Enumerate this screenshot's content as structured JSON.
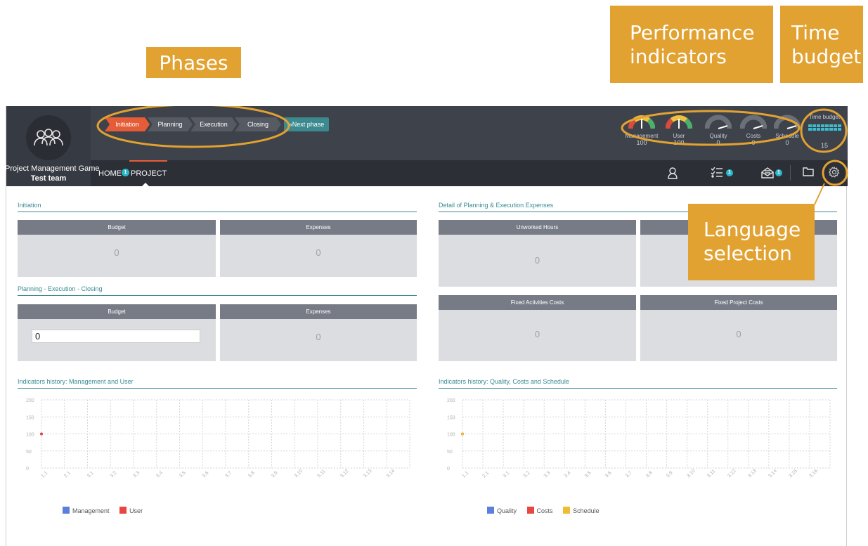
{
  "callouts": {
    "phases": "Phases",
    "performance_indicators": "Performance indicators",
    "time_budget": "Time budget",
    "language_selection": "Language selection"
  },
  "brand": {
    "name": "Project Management Game",
    "team": "Test team"
  },
  "phases": [
    {
      "label": "Initiation",
      "active": true
    },
    {
      "label": "Planning",
      "active": false
    },
    {
      "label": "Execution",
      "active": false
    },
    {
      "label": "Closing",
      "active": false
    }
  ],
  "next_phase_label": "»Next phase",
  "gauges": [
    {
      "label": "Management",
      "value": "100",
      "level": 0.5
    },
    {
      "label": "User",
      "value": "100",
      "level": 0.5
    },
    {
      "label": "Quality",
      "value": "0",
      "level": 0.0
    },
    {
      "label": "Costs",
      "value": "0",
      "level": 0.0
    },
    {
      "label": "Schedule",
      "value": "0",
      "level": 0.0
    }
  ],
  "time_budget": {
    "title": "Time budget",
    "value": "15",
    "cells": 16
  },
  "nav": {
    "home": "HOME",
    "badge": "1",
    "project": "PROJECT"
  },
  "toolbar": {
    "tasks_badge": "1",
    "messages_badge": "1"
  },
  "icons": [
    "users-icon",
    "user-icon",
    "task-list-icon",
    "inbox-icon",
    "folder-icon",
    "gear-icon"
  ],
  "initiation": {
    "title": "Initiation",
    "budget_label": "Budget",
    "budget_value": "0",
    "expenses_label": "Expenses",
    "expenses_value": "0"
  },
  "pec": {
    "title": "Planning - Execution - Closing",
    "budget_label": "Budget",
    "budget_input": "0",
    "expenses_label": "Expenses",
    "expenses_value": "0"
  },
  "detail": {
    "title": "Detail of Planning & Execution Expenses",
    "unworked_label": "Unworked Hours",
    "unworked_value": "0",
    "fixed_activities_label": "Fixed Activities Costs",
    "fixed_activities_value": "0",
    "fixed_project_label": "Fixed Project Costs",
    "fixed_project_value": "0"
  },
  "charts": {
    "left_title": "Indicators history: Management and User",
    "right_title": "Indicators history: Quality, Costs and Schedule"
  },
  "colors": {
    "accent": "#e65c36",
    "teal": "#3a8a92",
    "callout": "#e2a231",
    "management": "#5b7fdc",
    "user": "#e8473f",
    "quality": "#5b7fdc",
    "costs": "#e8473f",
    "schedule": "#f1bb33"
  },
  "chart_data": [
    {
      "type": "line",
      "title": "Indicators history: Management and User",
      "x": [
        "1.1",
        "2.1",
        "3.1",
        "3.2",
        "3.3",
        "3.4",
        "3.5",
        "3.6",
        "3.7",
        "3.8",
        "3.9",
        "3.10",
        "3.11",
        "3.12",
        "3.13",
        "3.14"
      ],
      "ylim": [
        0,
        200
      ],
      "yticks": [
        0,
        50,
        100,
        150,
        200
      ],
      "grid": true,
      "legend": "bottom",
      "series": [
        {
          "name": "Management",
          "color": "#5b7fdc",
          "values": [
            100
          ]
        },
        {
          "name": "User",
          "color": "#e8473f",
          "values": [
            100
          ]
        }
      ]
    },
    {
      "type": "line",
      "title": "Indicators history: Quality, Costs and Schedule",
      "x": [
        "1.1",
        "2.1",
        "3.1",
        "3.2",
        "3.3",
        "3.4",
        "3.5",
        "3.6",
        "3.7",
        "3.8",
        "3.9",
        "3.10",
        "3.11",
        "3.12",
        "3.13",
        "3.14",
        "3.15",
        "3.16"
      ],
      "ylim": [
        0,
        200
      ],
      "yticks": [
        0,
        50,
        100,
        150,
        200
      ],
      "grid": true,
      "legend": "bottom",
      "series": [
        {
          "name": "Quality",
          "color": "#5b7fdc",
          "values": [
            100
          ]
        },
        {
          "name": "Costs",
          "color": "#e8473f",
          "values": [
            100
          ]
        },
        {
          "name": "Schedule",
          "color": "#f1bb33",
          "values": [
            100
          ]
        }
      ]
    }
  ]
}
